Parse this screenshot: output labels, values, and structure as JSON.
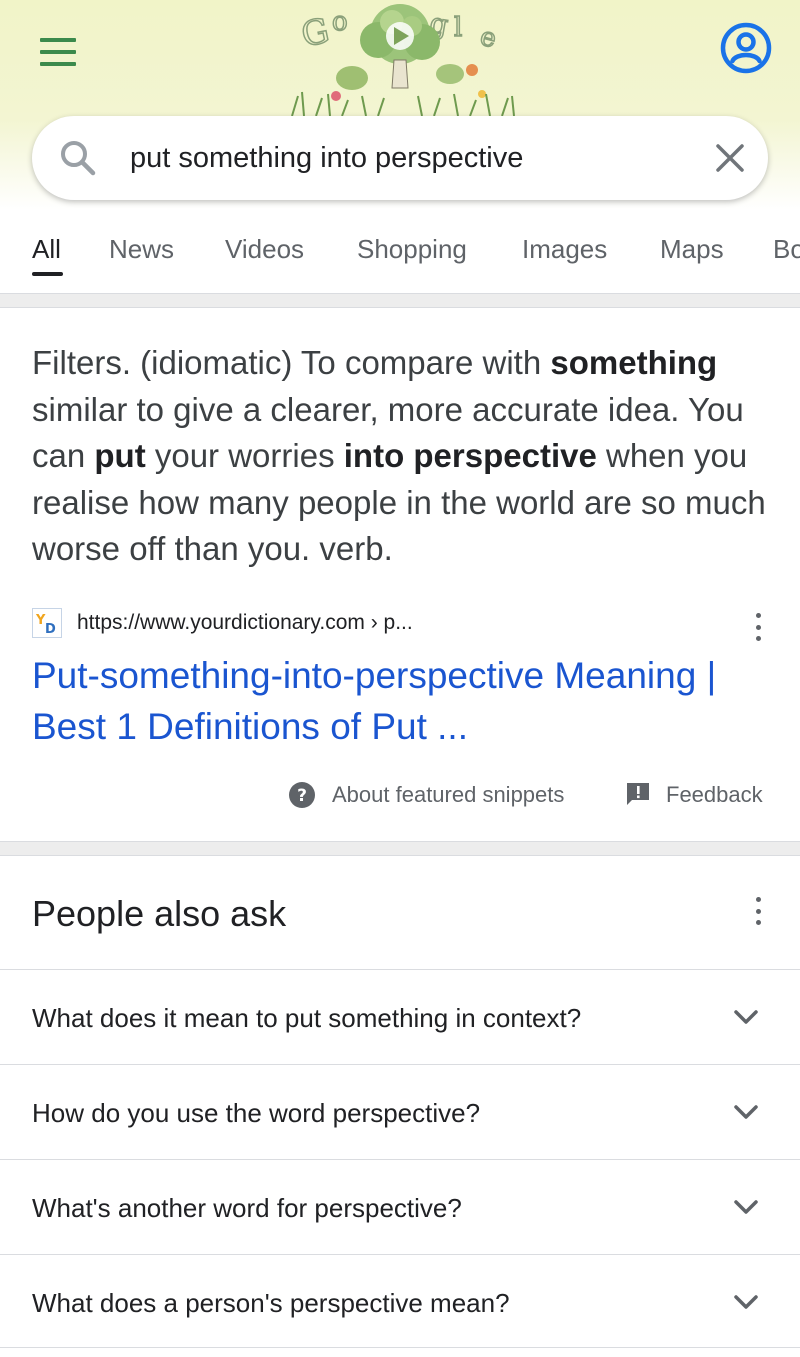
{
  "header": {
    "doodle_alt": "Google"
  },
  "search": {
    "query": "put something into perspective"
  },
  "tabs": [
    {
      "label": "All"
    },
    {
      "label": "News"
    },
    {
      "label": "Videos"
    },
    {
      "label": "Shopping"
    },
    {
      "label": "Images"
    },
    {
      "label": "Maps"
    },
    {
      "label": "Bo"
    }
  ],
  "snippet": {
    "parts": [
      "Filters. (idiomatic) To compare with ",
      "something",
      " similar to give a clearer, more accurate idea. You can ",
      "put",
      " your worries ",
      "into perspective",
      " when you realise how many people in the world are so much worse off than you. verb."
    ],
    "source_url": "https://www.yourdictionary.com › p...",
    "title": "Put-something-into-perspective Meaning | Best 1 Definitions of Put ...",
    "about_label": "About featured snippets",
    "feedback_label": "Feedback"
  },
  "people_also_ask": {
    "title": "People also ask",
    "questions": [
      "What does it mean to put something in context?",
      "How do you use the word perspective?",
      "What's another word for perspective?",
      "What does a person's perspective mean?"
    ]
  },
  "colors": {
    "link": "#1a55d0",
    "accent_blue": "#1a73e8",
    "menu_green": "#3c8a4c"
  },
  "icons": [
    "menu-icon",
    "account-icon",
    "search-icon",
    "clear-icon",
    "help-icon",
    "feedback-icon",
    "more-vert-icon",
    "chevron-down-icon"
  ]
}
